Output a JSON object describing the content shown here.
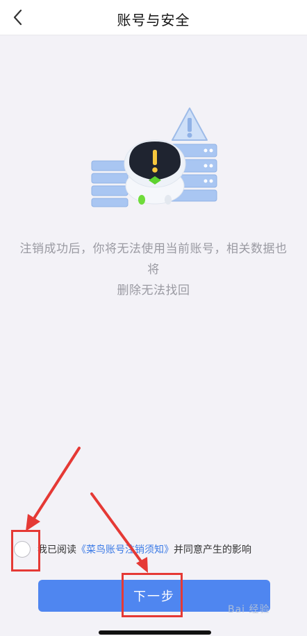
{
  "header": {
    "title": "账号与安全",
    "back_icon": "chevron-left-icon"
  },
  "notice": {
    "line1": "注销成功后，你将无法使用当前账号，相关数据也将",
    "line2": "删除无法找回"
  },
  "agreement": {
    "prefix": "我已阅读",
    "link_text": "《菜鸟账号注销须知》",
    "suffix": "并同意产生的影响",
    "checked": false
  },
  "primary_button": {
    "label": "下一步"
  },
  "watermark": {
    "text": "Bai 经验"
  },
  "colors": {
    "accent": "#4f86f0",
    "link": "#3c7be6",
    "annotation": "#e53935",
    "background": "#f3f2f7"
  }
}
